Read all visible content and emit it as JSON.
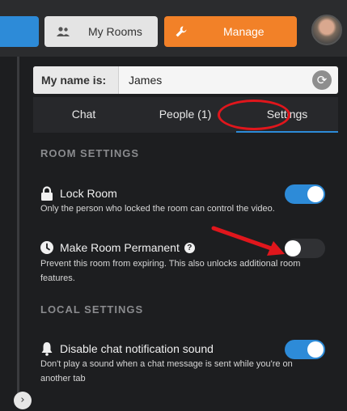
{
  "header": {
    "my_rooms_label": "My Rooms",
    "manage_label": "Manage"
  },
  "name_field": {
    "label": "My name is:",
    "value": "James"
  },
  "tabs": [
    {
      "label": "Chat"
    },
    {
      "label": "People (1)"
    },
    {
      "label": "Settings",
      "active": true
    }
  ],
  "room_settings": {
    "heading": "ROOM SETTINGS",
    "lock_room": {
      "title": "Lock Room",
      "description": "Only the person who locked the room can control the video.",
      "enabled": true
    },
    "make_permanent": {
      "title": "Make Room Permanent",
      "description": "Prevent this room from expiring. This also unlocks additional room features.",
      "enabled": false
    }
  },
  "local_settings": {
    "heading": "LOCAL SETTINGS",
    "disable_chat_sound": {
      "title": "Disable chat notification sound",
      "description": "Don't play a sound when a chat message is sent while you're on another tab",
      "enabled": true
    }
  },
  "colors": {
    "accent_blue": "#2d8bd8",
    "manage_orange": "#f28128",
    "annotation_red": "#e0161c",
    "panel_bg": "#1d1e20"
  },
  "icons": [
    "users-icon",
    "wrench-icon",
    "refresh-icon",
    "lock-icon",
    "clock-icon",
    "help-icon",
    "bell-icon",
    "chevron-right-icon"
  ]
}
